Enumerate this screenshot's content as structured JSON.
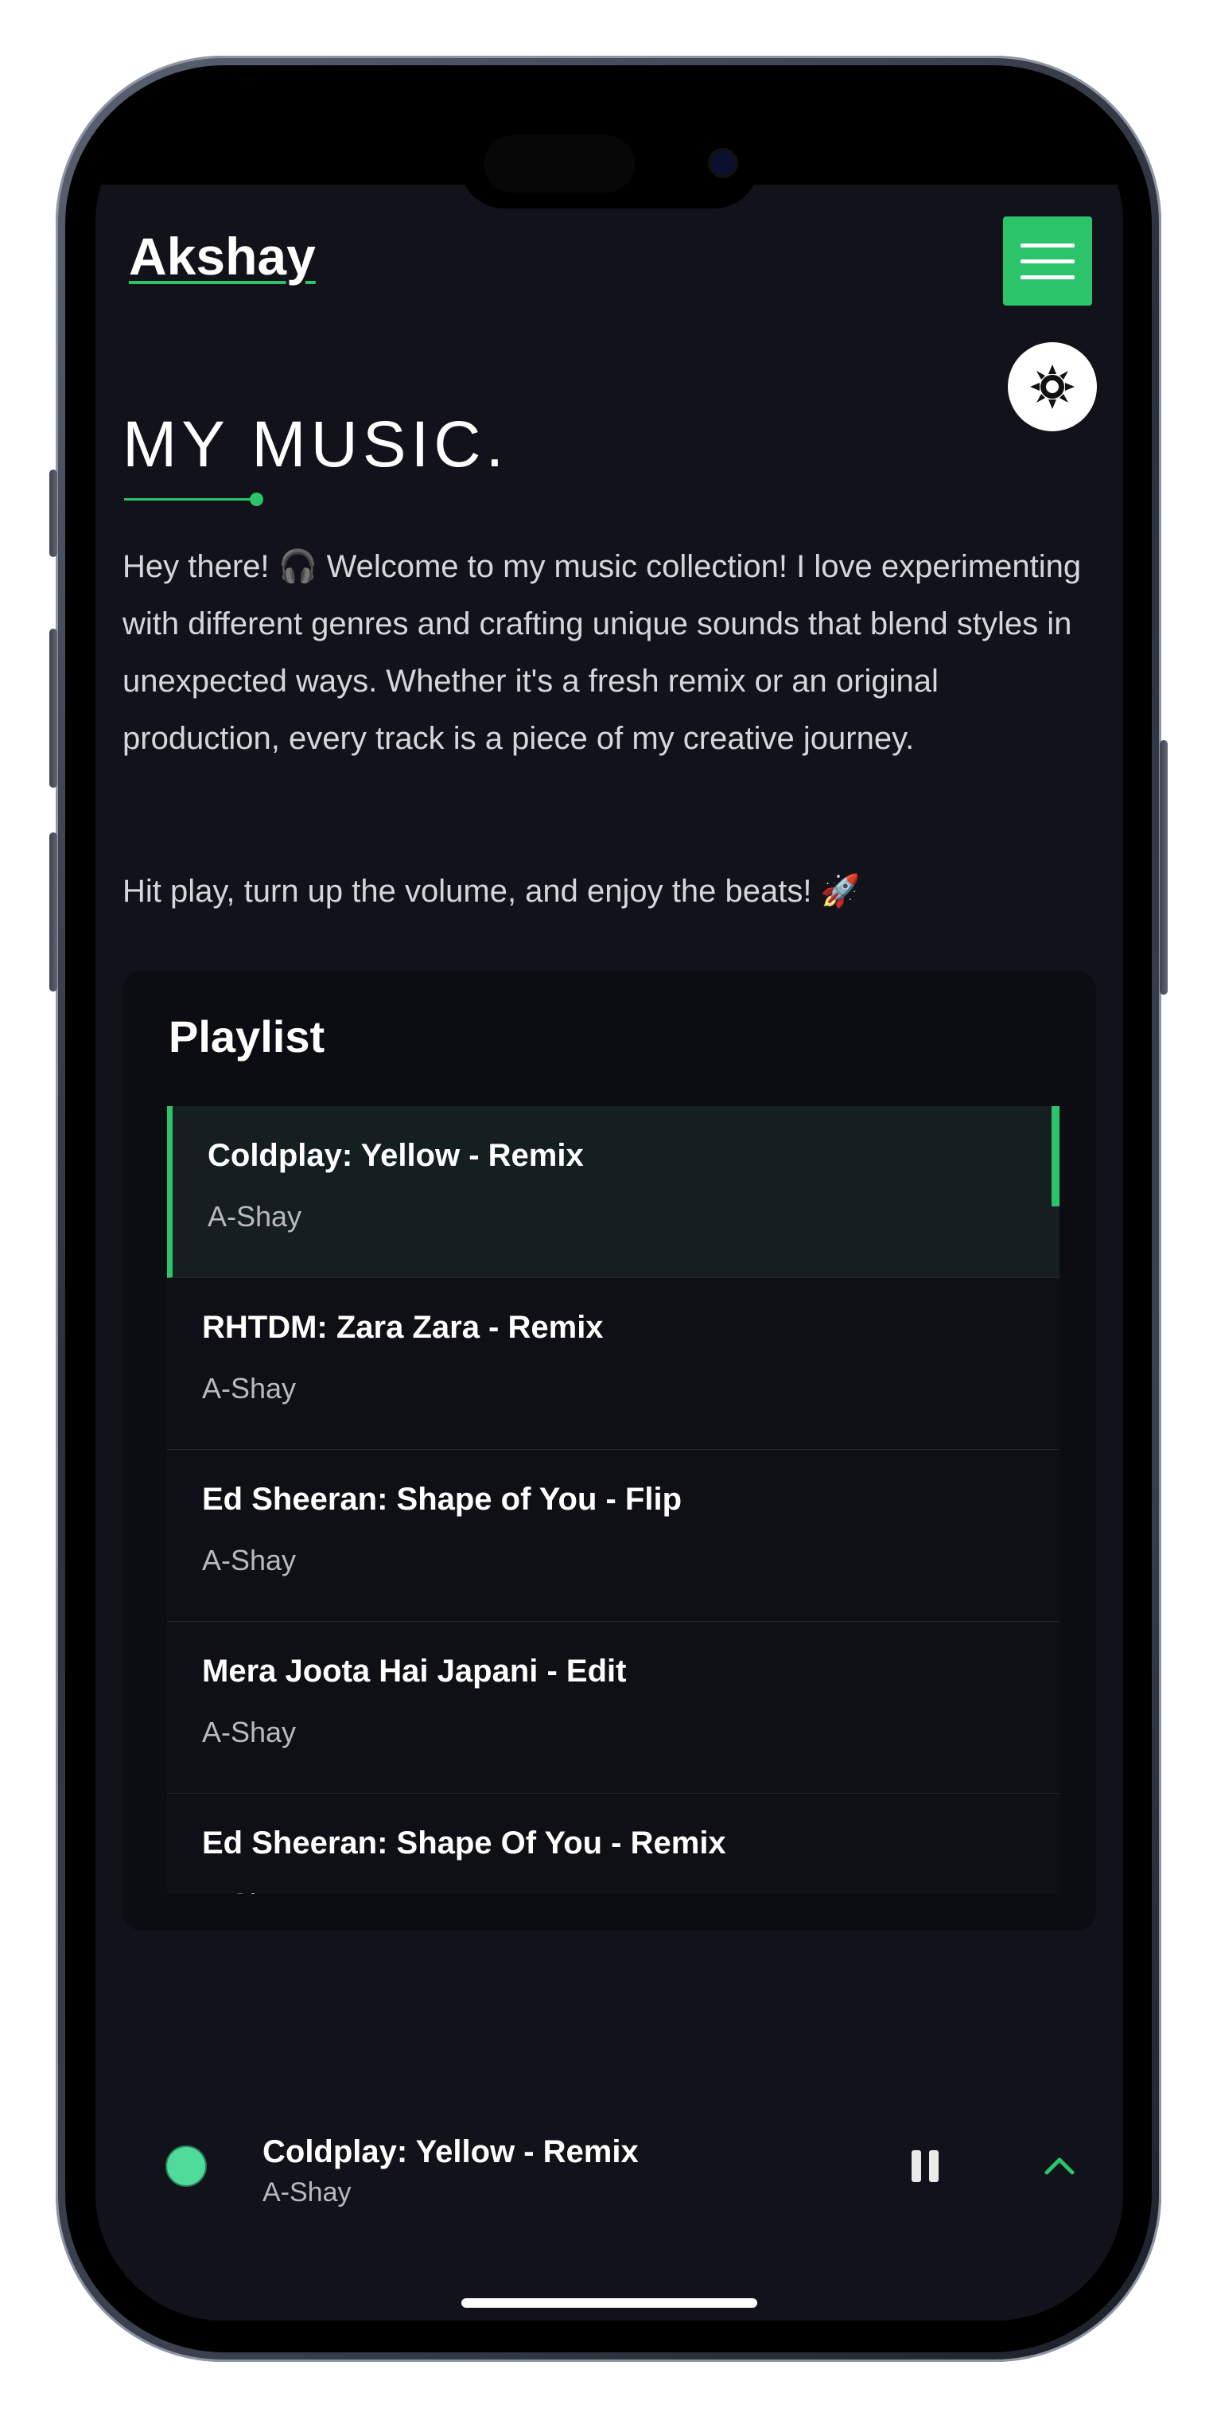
{
  "header": {
    "logo_text": "Akshay",
    "menu_icon": "hamburger-icon",
    "theme_icon": "sun-icon"
  },
  "hero": {
    "title": "MY MUSIC.",
    "intro_paragraph": "Hey there! 🎧 Welcome to my music collection! I love experimenting with different genres and crafting unique sounds that blend styles in unexpected ways. Whether it's a fresh remix or an original production, every track is a piece of my creative journey.",
    "outro_paragraph": "Hit play, turn up the volume, and enjoy the beats! 🚀"
  },
  "playlist": {
    "title": "Playlist",
    "tracks": [
      {
        "title": "Coldplay: Yellow - Remix",
        "artist": "A-Shay"
      },
      {
        "title": "RHTDM: Zara Zara - Remix",
        "artist": "A-Shay"
      },
      {
        "title": "Ed Sheeran: Shape of You - Flip",
        "artist": "A-Shay"
      },
      {
        "title": "Mera Joota Hai Japani - Edit",
        "artist": "A-Shay"
      },
      {
        "title": "Ed Sheeran: Shape Of You - Remix",
        "artist": "A-Shay"
      }
    ]
  },
  "player": {
    "now_playing_title": "Coldplay: Yellow - Remix",
    "now_playing_artist": "A-Shay",
    "pause_icon": "pause-icon",
    "expand_icon": "chevron-up-icon"
  },
  "colors": {
    "accent": "#2cc46b",
    "background": "#12131a",
    "card": "#0c0d12"
  }
}
